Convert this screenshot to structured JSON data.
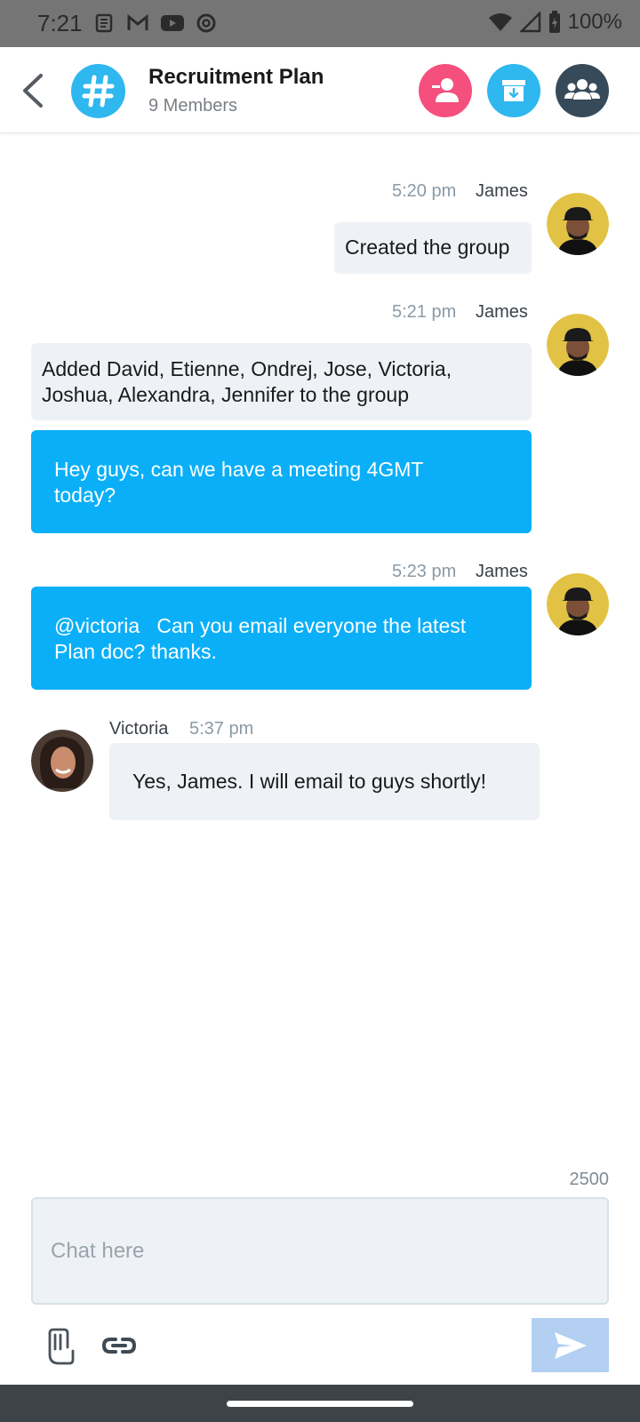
{
  "status_bar": {
    "time": "7:21",
    "battery": "100%"
  },
  "header": {
    "title": "Recruitment Plan",
    "subtitle": "9 Members",
    "channel_symbol": "#",
    "icons": [
      "back-icon",
      "remove-user-icon",
      "archive-icon",
      "members-icon"
    ]
  },
  "messages": [
    {
      "sender": "James",
      "time": "5:20 pm",
      "bubbles": [
        "Created the group"
      ]
    },
    {
      "sender": "James",
      "time": "5:21 pm",
      "bubbles": [
        "Added David, Etienne, Ondrej, Jose, Victoria, Joshua, Alexandra, Jennifer to the group",
        "Hey guys, can we have a meeting 4GMT today?"
      ]
    },
    {
      "sender": "James",
      "time": "5:23 pm",
      "bubbles": [
        "@victoria   Can you email everyone the latest Plan doc? thanks."
      ]
    },
    {
      "sender": "Victoria",
      "time": "5:37 pm",
      "bubbles": [
        "Yes, James. I will email to guys shortly!"
      ]
    }
  ],
  "composer": {
    "char_count": "2500",
    "placeholder": "Chat here",
    "value": ""
  },
  "colors": {
    "accent_blue": "#0aaff8",
    "remove_pink": "#f5507d",
    "archive_blue": "#2fb7ef",
    "members_dark": "#374a59",
    "send_disabled": "#b3d0f3"
  }
}
